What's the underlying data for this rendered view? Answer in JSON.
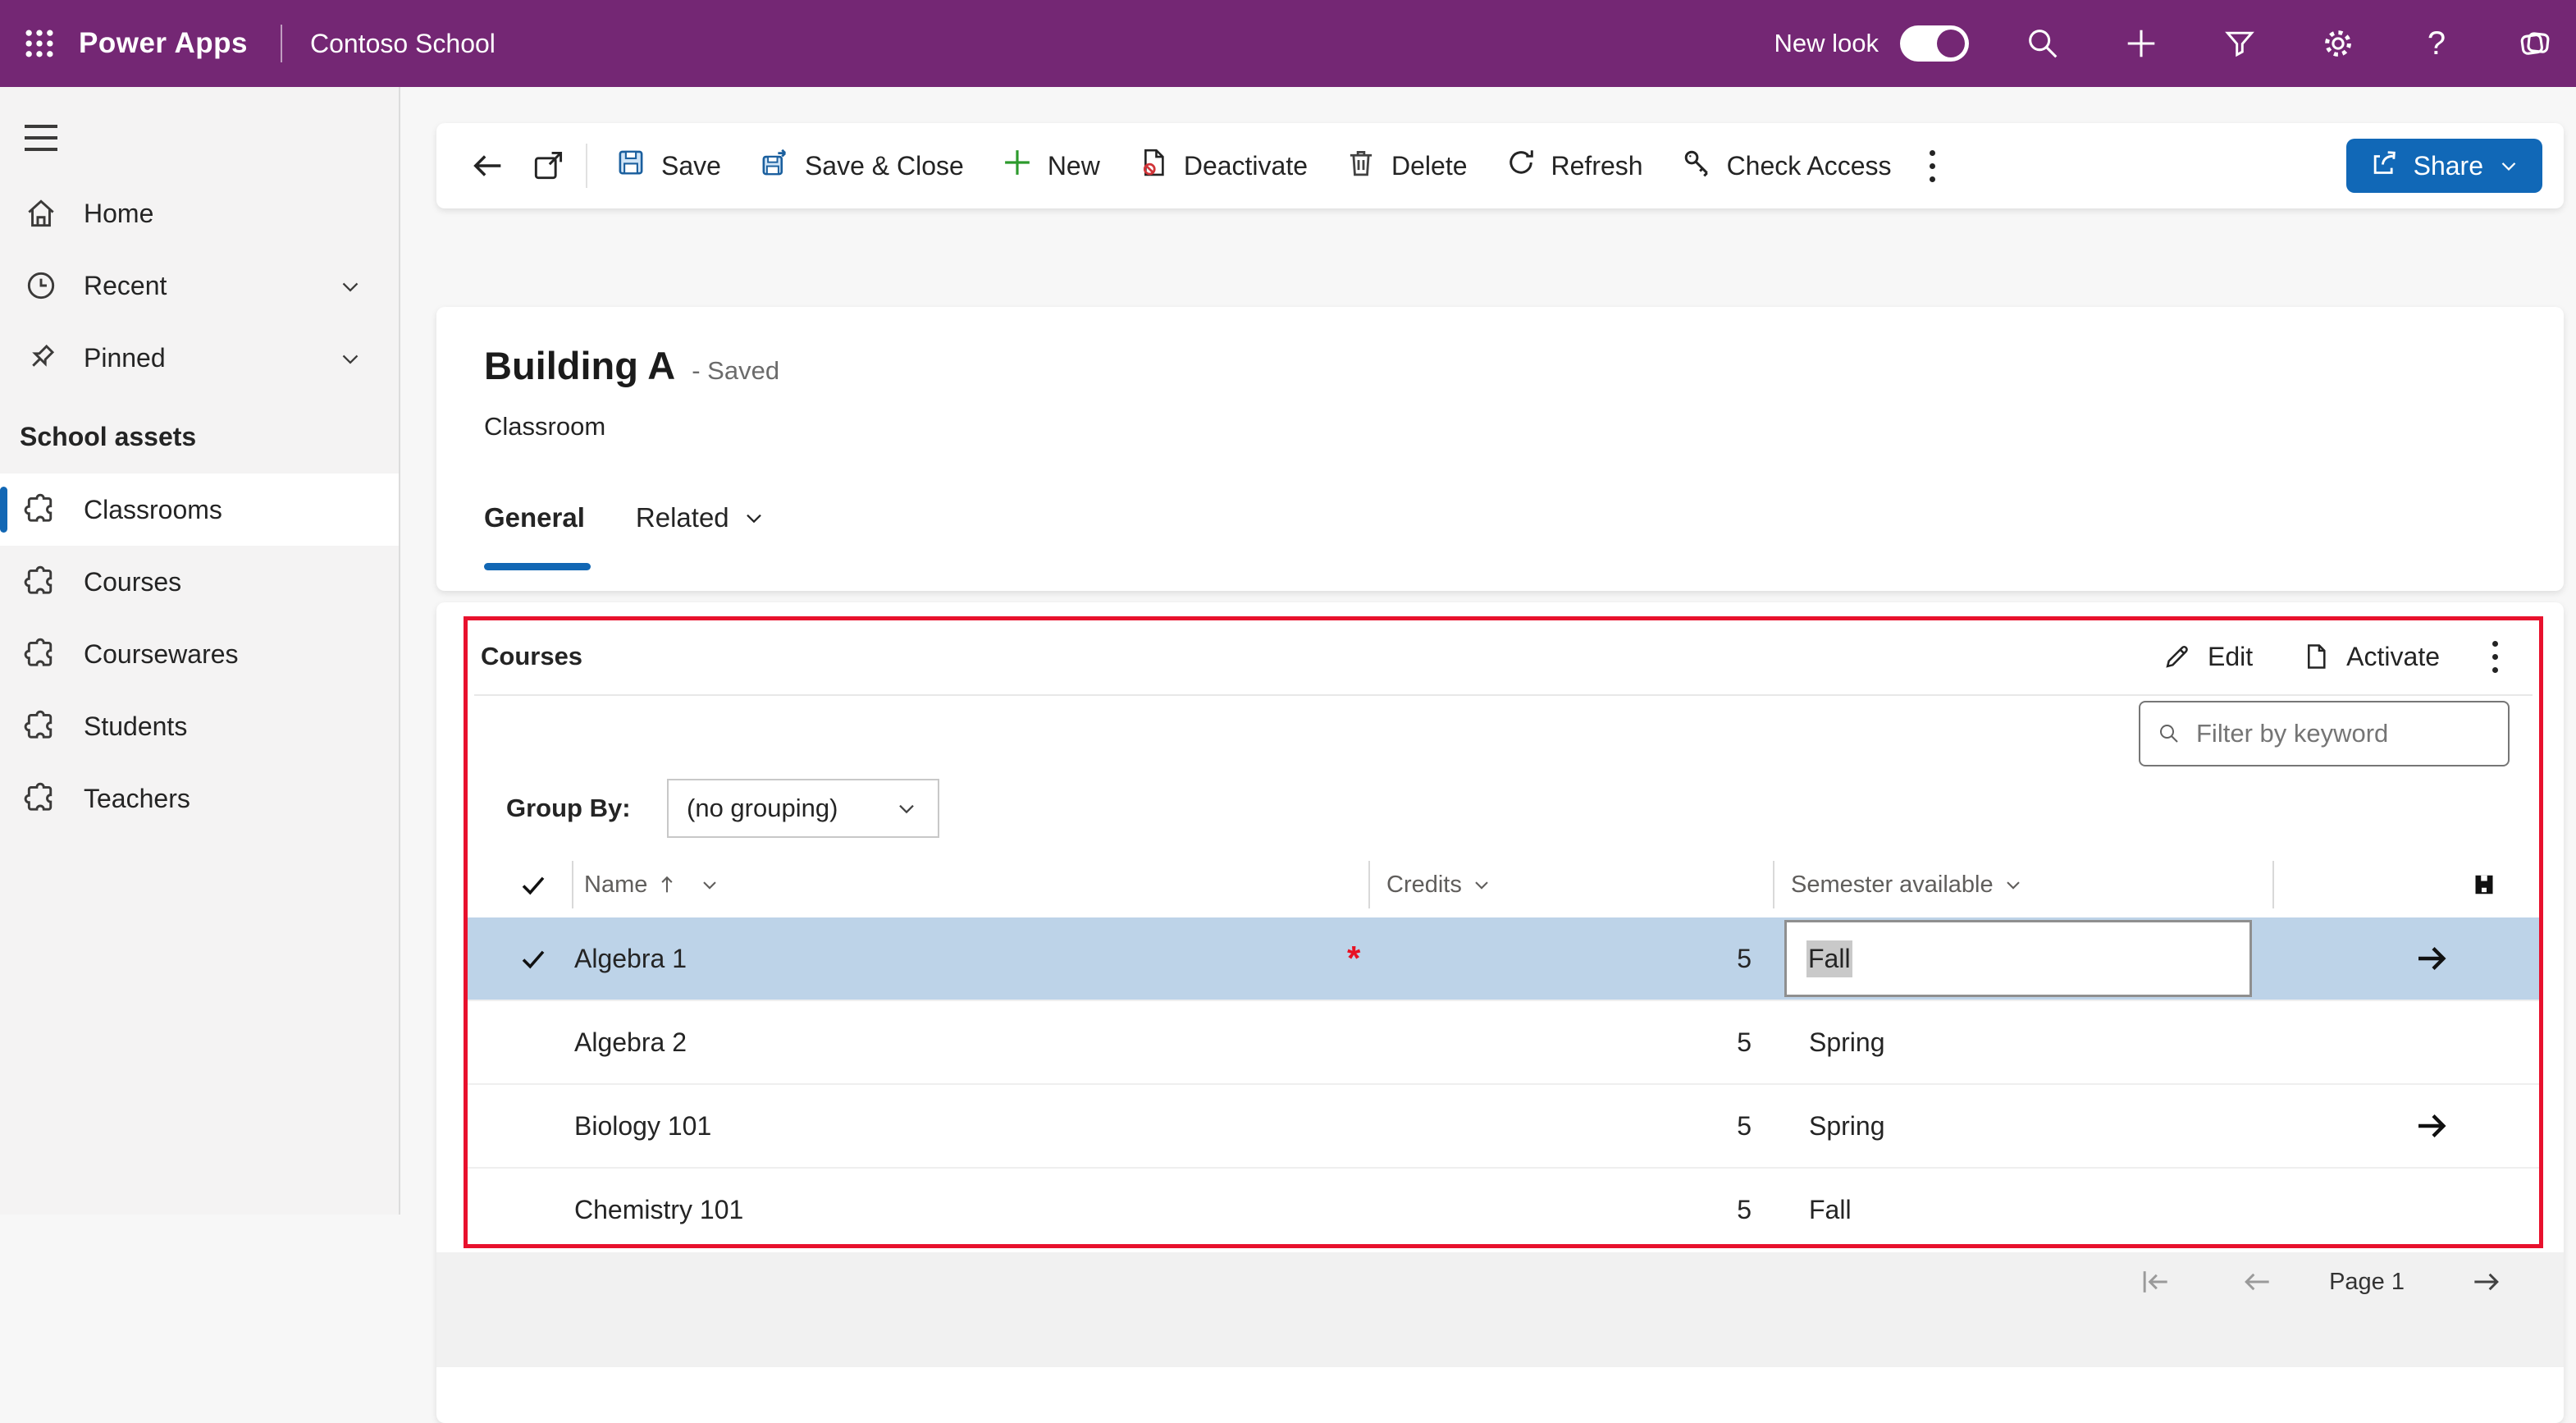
{
  "colors": {
    "brand_purple": "#742774",
    "accent_blue": "#1267b4",
    "share_blue": "#1168b7",
    "selected_row_blue": "#bdd3e8",
    "annotation_red": "#e8112d",
    "new_button_green": "#2c9a2c",
    "deactivate_red": "#d13438"
  },
  "top_bar": {
    "app_name": "Power Apps",
    "environment": "Contoso School",
    "new_look": {
      "label": "New look",
      "state": "on"
    },
    "icons": [
      "waffle",
      "search",
      "add",
      "filter",
      "settings",
      "help",
      "copilot"
    ]
  },
  "command_bar": {
    "back": "back-arrow",
    "popout": "open-in-new-window",
    "save": "Save",
    "save_close": "Save & Close",
    "new": "New",
    "deactivate": "Deactivate",
    "delete": "Delete",
    "refresh": "Refresh",
    "check_access": "Check Access",
    "more": "more-commands",
    "share": "Share"
  },
  "sidebar": {
    "items": [
      {
        "label": "Home",
        "icon": "home"
      },
      {
        "label": "Recent",
        "icon": "clock",
        "expandable": true
      },
      {
        "label": "Pinned",
        "icon": "pin",
        "expandable": true
      }
    ],
    "group_label": "School assets",
    "entities": [
      {
        "label": "Classrooms",
        "icon": "puzzle",
        "selected": true
      },
      {
        "label": "Courses",
        "icon": "puzzle",
        "selected": false
      },
      {
        "label": "Coursewares",
        "icon": "puzzle",
        "selected": false
      },
      {
        "label": "Students",
        "icon": "puzzle",
        "selected": false
      },
      {
        "label": "Teachers",
        "icon": "puzzle",
        "selected": false
      }
    ]
  },
  "record": {
    "title": "Building A",
    "save_status": "- Saved",
    "entity_type": "Classroom",
    "tabs": [
      {
        "label": "General",
        "active": true
      },
      {
        "label": "Related",
        "active": false,
        "has_dropdown": true
      }
    ]
  },
  "courses": {
    "title": "Courses",
    "edit_label": "Edit",
    "activate_label": "Activate",
    "filter_placeholder": "Filter by keyword",
    "group_by_label": "Group By:",
    "group_by_value": "(no grouping)",
    "columns": [
      {
        "label": "Name",
        "sorted": "ascending",
        "has_dropdown": true
      },
      {
        "label": "Credits",
        "has_dropdown": true
      },
      {
        "label": "Semester available",
        "has_dropdown": true
      }
    ],
    "rows": [
      {
        "name": "Algebra 1",
        "credits": "5",
        "semester": "Fall",
        "selected": true,
        "editing_semester": true,
        "required_marker": "*",
        "has_arrow": true
      },
      {
        "name": "Algebra 2",
        "credits": "5",
        "semester": "Spring",
        "selected": false,
        "has_arrow": false
      },
      {
        "name": "Biology 101",
        "credits": "5",
        "semester": "Spring",
        "selected": false,
        "has_arrow": true
      },
      {
        "name": "Chemistry 101",
        "credits": "5",
        "semester": "Fall",
        "selected": false,
        "has_arrow": false
      }
    ],
    "pagination": {
      "page_label": "Page 1"
    }
  }
}
